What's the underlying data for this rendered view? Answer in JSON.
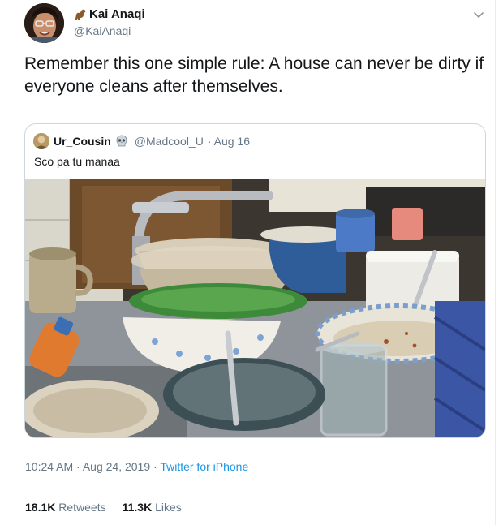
{
  "author": {
    "display_name": "Kai Anaqi",
    "handle": "@KaiAnaqi",
    "name_emoji": "dinosaur-emoji"
  },
  "tweet": {
    "text": "Remember this one simple rule: A house can never be dirty if everyone cleans after themselves."
  },
  "quote": {
    "name": "Ur_Cousin",
    "name_emoji": "skull-emoji",
    "handle": "@Madcool_U",
    "date": "· Aug 16",
    "text": "Sco pa tu manaa",
    "image": "photo-of-sink-full-of-dirty-dishes"
  },
  "meta": {
    "time": "10:24 AM · Aug 24, 2019 · ",
    "source": "Twitter for iPhone"
  },
  "stats": {
    "retweets_count": "18.1K",
    "retweets_label": "Retweets",
    "likes_count": "11.3K",
    "likes_label": "Likes"
  },
  "colors": {
    "link": "#1b95e0",
    "secondary": "#657786",
    "border": "#e6ecf0"
  }
}
